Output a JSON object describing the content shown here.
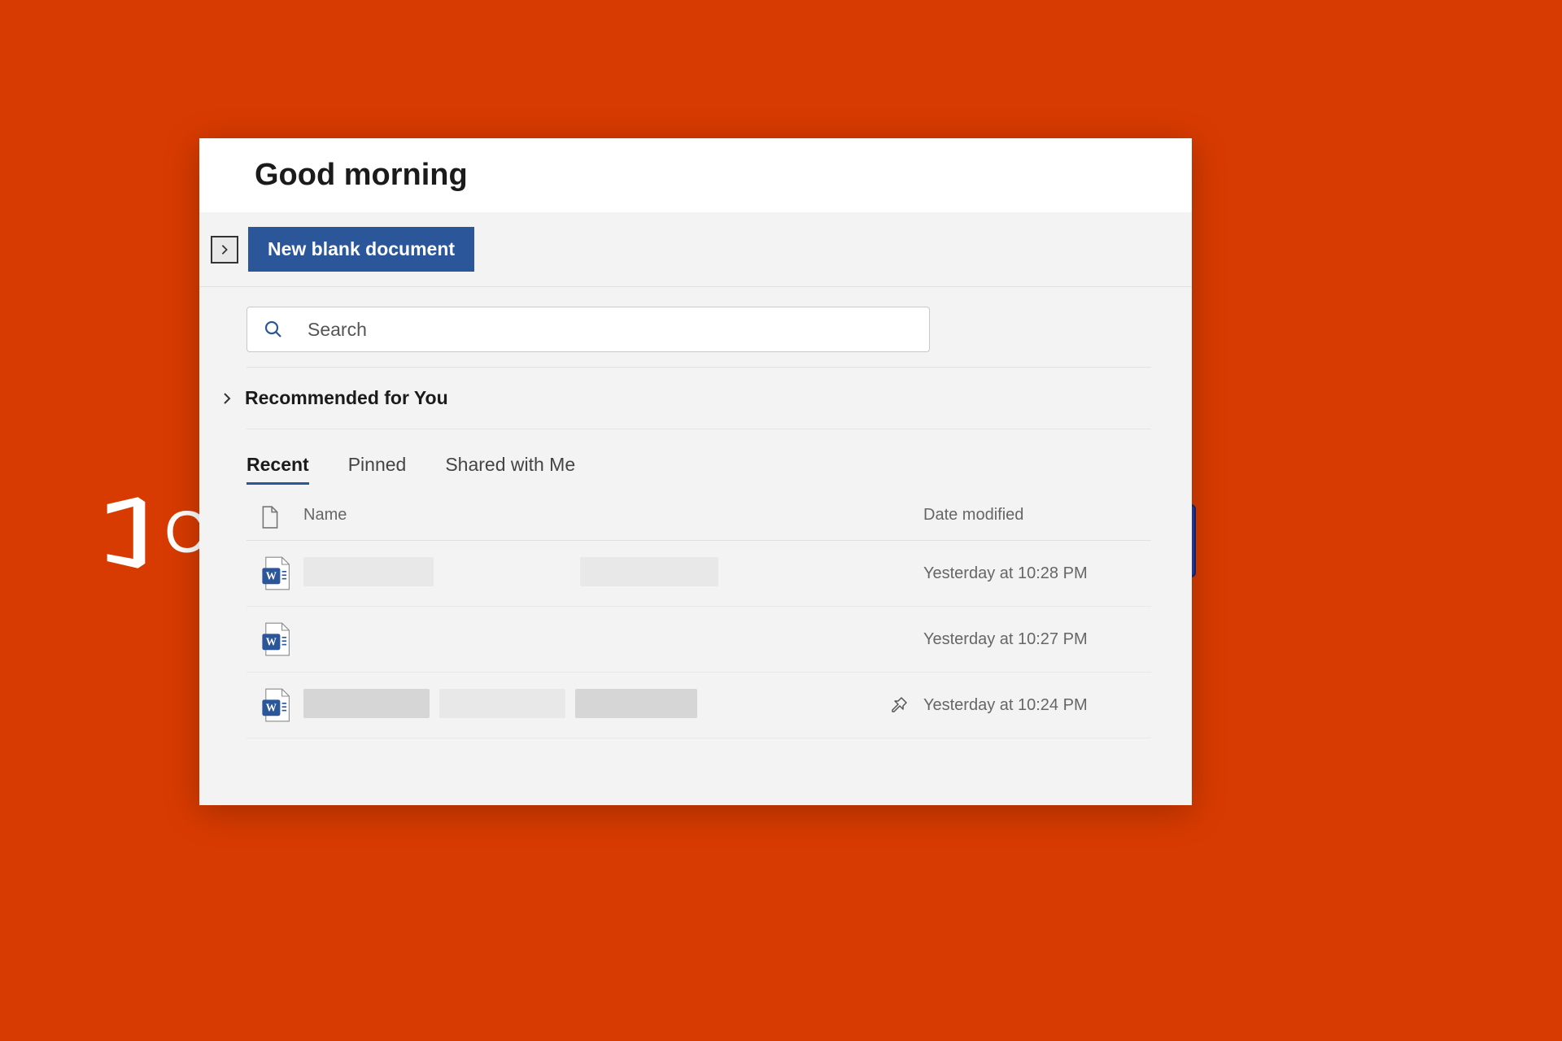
{
  "background": {
    "logo_partial_text": "C"
  },
  "header": {
    "greeting": "Good morning"
  },
  "actions": {
    "new_doc_label": "New blank document"
  },
  "search": {
    "placeholder": "Search"
  },
  "recommended": {
    "label": "Recommended for You"
  },
  "tabs": [
    {
      "label": "Recent",
      "active": true
    },
    {
      "label": "Pinned",
      "active": false
    },
    {
      "label": "Shared with Me",
      "active": false
    }
  ],
  "table": {
    "col_name": "Name",
    "col_date": "Date modified",
    "rows": [
      {
        "date": "Yesterday at 10:28 PM",
        "pinned": false
      },
      {
        "date": "Yesterday at 10:27 PM",
        "pinned": false
      },
      {
        "date": "Yesterday at 10:24 PM",
        "pinned": true
      }
    ]
  }
}
